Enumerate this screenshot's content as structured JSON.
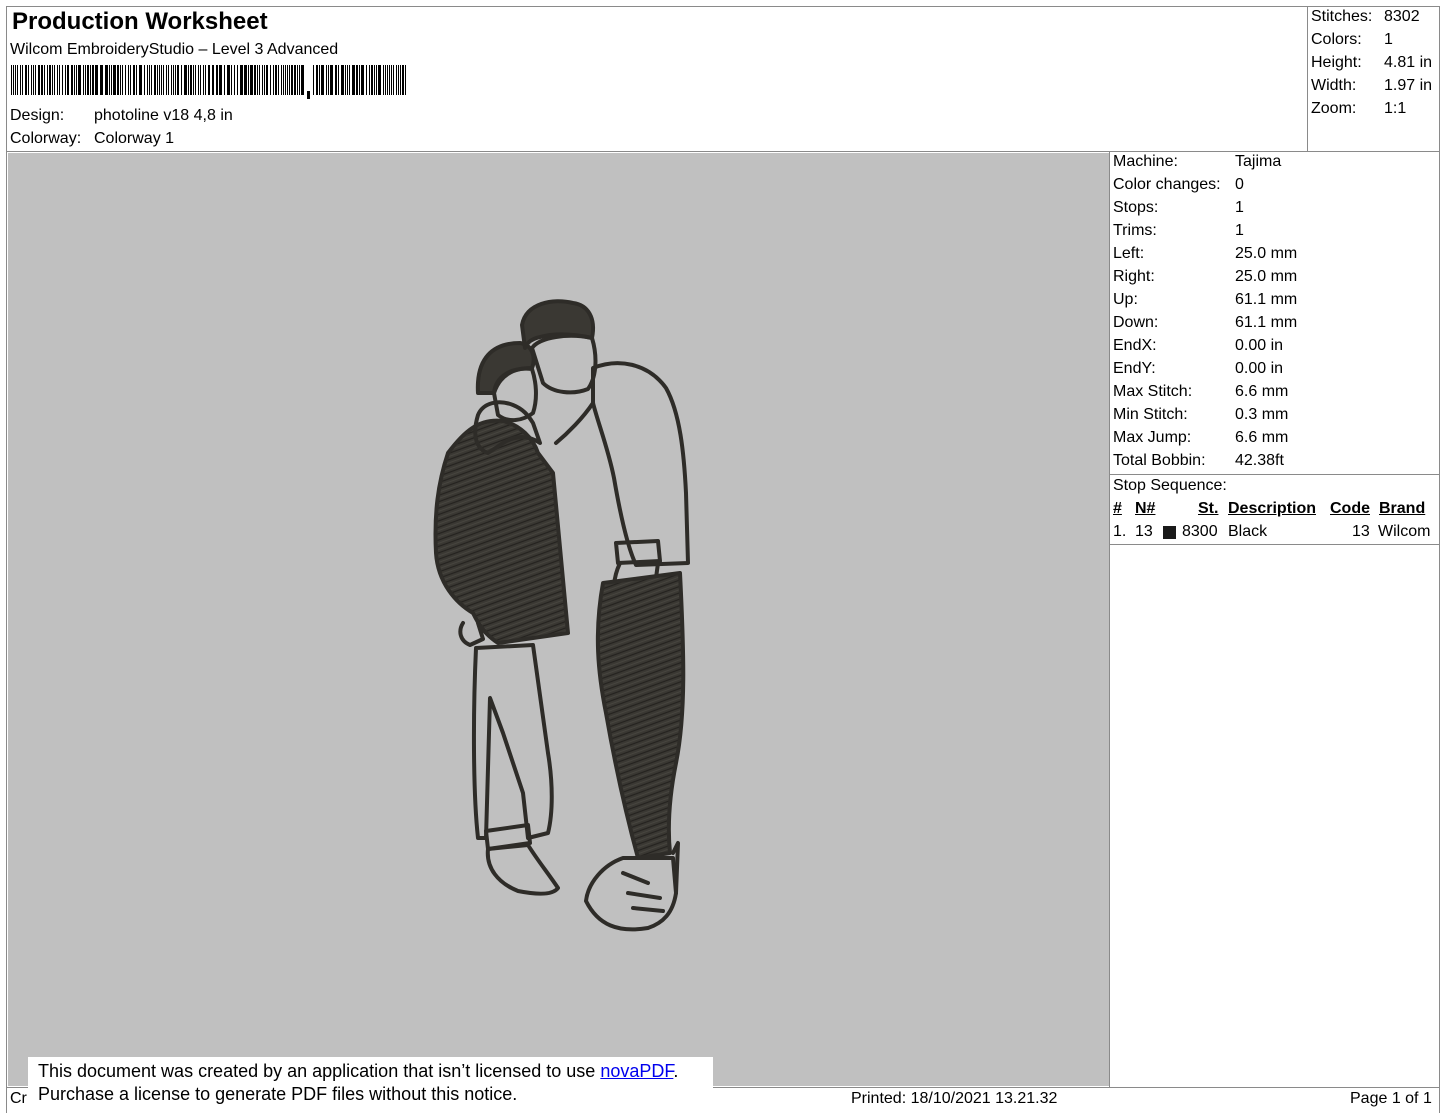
{
  "header": {
    "title": "Production Worksheet",
    "software": "Wilcom EmbroideryStudio – Level 3 Advanced",
    "design_label": "Design:",
    "design_value": "photoline v18 4,8 in",
    "colorway_label": "Colorway:",
    "colorway_value": "Colorway 1"
  },
  "summary": [
    {
      "label": "Stitches:",
      "value": "8302"
    },
    {
      "label": "Colors:",
      "value": "1"
    },
    {
      "label": "Height:",
      "value": "4.81 in"
    },
    {
      "label": "Width:",
      "value": "1.97 in"
    },
    {
      "label": "Zoom:",
      "value": "1:1"
    }
  ],
  "machine_info": [
    {
      "label": "Machine:",
      "value": "Tajima"
    },
    {
      "label": "Color changes:",
      "value": "0"
    },
    {
      "label": "Stops:",
      "value": "1"
    },
    {
      "label": "Trims:",
      "value": "1"
    },
    {
      "label": "Left:",
      "value": "25.0 mm"
    },
    {
      "label": "Right:",
      "value": "25.0 mm"
    },
    {
      "label": "Up:",
      "value": "61.1 mm"
    },
    {
      "label": "Down:",
      "value": "61.1 mm"
    },
    {
      "label": "EndX:",
      "value": "0.00 in"
    },
    {
      "label": "EndY:",
      "value": "0.00 in"
    },
    {
      "label": "Max Stitch:",
      "value": "6.6 mm"
    },
    {
      "label": "Min Stitch:",
      "value": "0.3 mm"
    },
    {
      "label": "Max Jump:",
      "value": "6.6 mm"
    },
    {
      "label": "Total Bobbin:",
      "value": "42.38ft"
    }
  ],
  "stop_sequence": {
    "title": "Stop Sequence:",
    "columns": [
      "#",
      "N#",
      "St.",
      "Description",
      "Code",
      "Brand"
    ],
    "rows": [
      {
        "index": "1.",
        "needle": "13",
        "swatch_color": "#1a1a1a",
        "stitches": "8300",
        "description": "Black",
        "code": "13",
        "brand": "Wilcom"
      }
    ]
  },
  "notice": {
    "line1_prefix": "This document was created by an application that isn’t licensed to use ",
    "link_text": "novaPDF",
    "line1_suffix": ".",
    "line2": "Purchase a license to generate PDF files without this notice."
  },
  "footer": {
    "left_fragment": "Cr",
    "printed": "Printed: 18/10/2021 13.21.32",
    "page": "Page 1 of 1"
  },
  "colors": {
    "canvas_bg": "#c0c0c0",
    "thread": "#2e2c28",
    "link": "#0000ee"
  }
}
